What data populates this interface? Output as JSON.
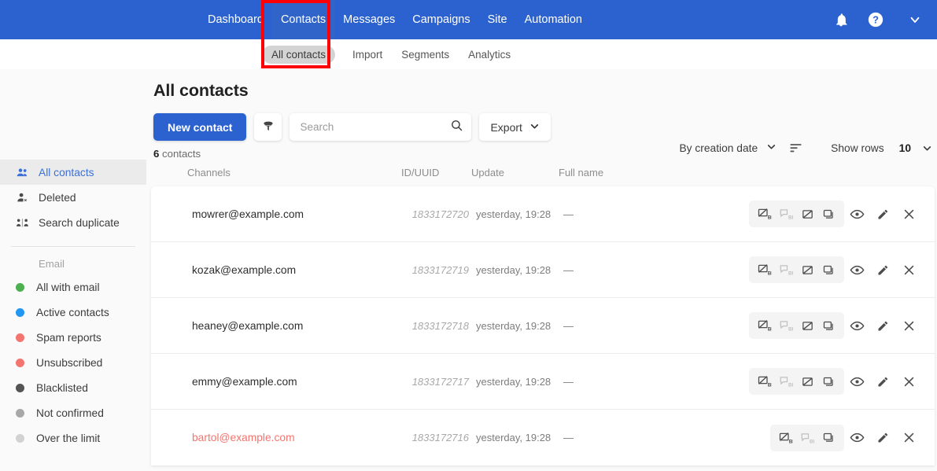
{
  "theme": {
    "brand_blue": "#2b62d0",
    "brand_blue_active": "#3064c9",
    "annotation_red": "#fb0007",
    "danger_text": "#f4756f",
    "page_bg": "#fafafa"
  },
  "topnav": {
    "items": [
      {
        "label": "Dashboard",
        "active": false
      },
      {
        "label": "Contacts",
        "active": true
      },
      {
        "label": "Messages",
        "active": false
      },
      {
        "label": "Campaigns",
        "active": false
      },
      {
        "label": "Site",
        "active": false
      },
      {
        "label": "Automation",
        "active": false
      }
    ],
    "icons": [
      "bell-icon",
      "help-icon",
      "chevron-down-icon"
    ]
  },
  "subnav": {
    "items": [
      {
        "label": "All contacts",
        "active": true
      },
      {
        "label": "Import",
        "active": false
      },
      {
        "label": "Segments",
        "active": false
      },
      {
        "label": "Analytics",
        "active": false
      }
    ]
  },
  "sidebar": {
    "primary": [
      {
        "label": "All contacts",
        "icon": "users-icon",
        "active": true
      },
      {
        "label": "Deleted",
        "icon": "user-remove-icon",
        "active": false
      },
      {
        "label": "Search duplicate",
        "icon": "duplicate-users-icon",
        "active": false
      }
    ],
    "group_label": "Email",
    "filters": [
      {
        "label": "All with email",
        "color": "#4caf50"
      },
      {
        "label": "Active contacts",
        "color": "#2196f3"
      },
      {
        "label": "Spam reports",
        "color": "#f4756f"
      },
      {
        "label": "Unsubscribed",
        "color": "#f4756f"
      },
      {
        "label": "Blacklisted",
        "color": "#545454"
      },
      {
        "label": "Not confirmed",
        "color": "#a8a8a8"
      },
      {
        "label": "Over the limit",
        "color": "#d2d2d2"
      }
    ]
  },
  "page": {
    "title": "All contacts",
    "new_contact_label": "New contact",
    "filter_icon": "funnel-icon",
    "search_placeholder": "Search",
    "search_value": "",
    "search_icon": "search-icon",
    "export_label": "Export",
    "export_caret": "chevron-down-icon",
    "count_number": "6",
    "count_label": "contacts"
  },
  "rowcontrols": {
    "sort_by": "By creation date",
    "sort_caret": "chevron-down-icon",
    "sort_order_icon": "sort-descending-icon",
    "show_rows_label": "Show rows",
    "show_rows_value": "10",
    "show_rows_caret": "chevron-down-icon"
  },
  "table": {
    "columns": [
      "Channels",
      "ID/UUID",
      "Update",
      "Full name"
    ],
    "rows": [
      {
        "email": "mowrer@example.com",
        "id": "1833172720",
        "update": "yesterday, 19:28",
        "full_name": "—",
        "danger": false,
        "chips": [
          "email-blacklist-icon",
          "sms-blacklist-icon",
          "unsubscribe-icon",
          "duplicate-icon"
        ]
      },
      {
        "email": "kozak@example.com",
        "id": "1833172719",
        "update": "yesterday, 19:28",
        "full_name": "—",
        "danger": false,
        "chips": [
          "email-blacklist-icon",
          "sms-blacklist-icon",
          "unsubscribe-icon",
          "duplicate-icon"
        ]
      },
      {
        "email": "heaney@example.com",
        "id": "1833172718",
        "update": "yesterday, 19:28",
        "full_name": "—",
        "danger": false,
        "chips": [
          "email-blacklist-icon",
          "sms-blacklist-icon",
          "unsubscribe-icon",
          "duplicate-icon"
        ]
      },
      {
        "email": "emmy@example.com",
        "id": "1833172717",
        "update": "yesterday, 19:28",
        "full_name": "—",
        "danger": false,
        "chips": [
          "email-blacklist-icon",
          "sms-blacklist-icon",
          "unsubscribe-icon",
          "duplicate-icon"
        ]
      },
      {
        "email": "bartol@example.com",
        "id": "1833172716",
        "update": "yesterday, 19:28",
        "full_name": "—",
        "danger": true,
        "chips": [
          "email-blacklist-icon",
          "sms-blacklist-icon",
          "duplicate-icon"
        ]
      }
    ],
    "row_action_icons": [
      "view-icon",
      "edit-icon",
      "delete-icon"
    ]
  }
}
